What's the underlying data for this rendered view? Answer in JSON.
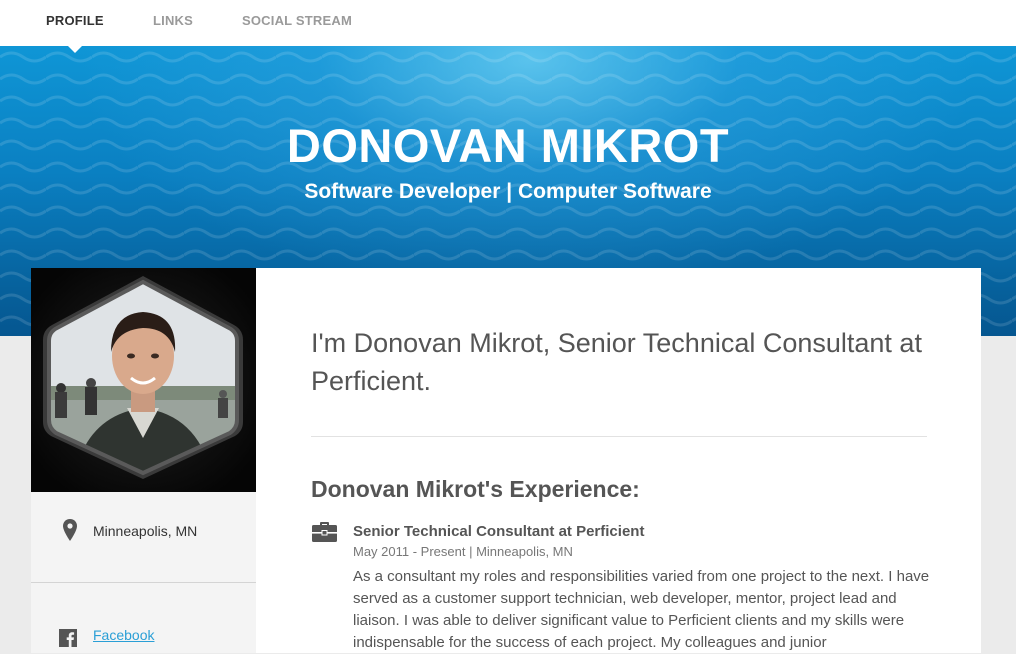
{
  "nav": {
    "tabs": [
      {
        "label": "PROFILE",
        "active": true
      },
      {
        "label": "LINKS",
        "active": false
      },
      {
        "label": "SOCIAL STREAM",
        "active": false
      }
    ]
  },
  "hero": {
    "name": "DONOVAN MIKROT",
    "subtitle": "Software Developer | Computer Software"
  },
  "sidebar": {
    "location": "Minneapolis, MN",
    "location_icon": "map-pin-icon",
    "links": [
      {
        "label": "Facebook",
        "icon": "facebook-icon"
      }
    ]
  },
  "main": {
    "intro": "I'm Donovan Mikrot, Senior Technical Consultant at Perficient.",
    "experience_heading": "Donovan Mikrot's Experience:",
    "jobs": [
      {
        "icon": "briefcase-icon",
        "title": "Senior Technical Consultant at Perficient",
        "meta": "May 2011 - Present | Minneapolis, MN",
        "description": "As a consultant my roles and responsibilities varied from one project to the next. I have served as a customer support technician, web developer, mentor, project lead and liaison. I was able to deliver significant value to Perficient clients and my skills were indispensable for the success of each project. My colleagues and junior"
      }
    ]
  },
  "colors": {
    "hero_blue": "#0a7fc1",
    "link": "#2a9fd6",
    "page_bg": "#ebebeb"
  }
}
